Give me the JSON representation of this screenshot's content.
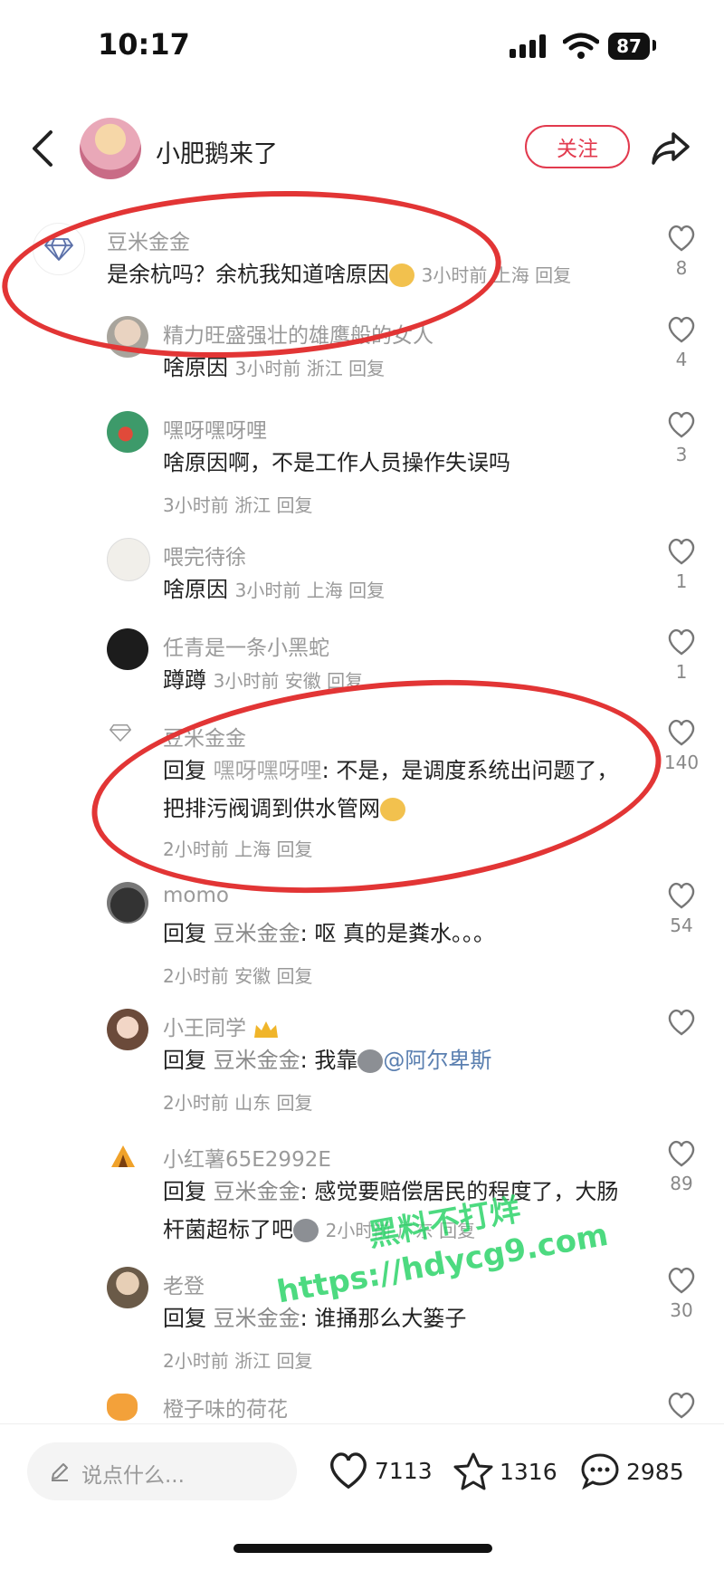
{
  "status": {
    "time": "10:17",
    "battery": "87"
  },
  "header": {
    "username": "小肥鹅来了",
    "follow_label": "关注"
  },
  "comments": [
    {
      "name": "豆米金金",
      "text": "是余杭吗？余杭我知道啥原因",
      "meta": "3小时前 上海 回复",
      "likes": "8"
    },
    {
      "name": "精力旺盛强壮的雄鹰般的女人",
      "text": "啥原因",
      "meta": "3小时前 浙江 回复",
      "likes": "4"
    },
    {
      "name": "嘿呀嘿呀哩",
      "text": "啥原因啊，不是工作人员操作失误吗",
      "meta": "3小时前 浙江 回复",
      "likes": "3"
    },
    {
      "name": "喂完待徐",
      "text": "啥原因",
      "meta": "3小时前 上海 回复",
      "likes": "1"
    },
    {
      "name": "任青是一条小黑蛇",
      "text": "蹲蹲",
      "meta": "3小时前 安徽 回复",
      "likes": "1"
    },
    {
      "name": "豆米金金",
      "reply_prefix": "回复",
      "reply_to": "嘿呀嘿呀哩",
      "text": ": 不是，是调度系统出问题了，把排污阀调到供水管网",
      "meta": "2小时前 上海 回复",
      "likes": "140"
    },
    {
      "name": "momo",
      "reply_prefix": "回复",
      "reply_to": "豆米金金",
      "text": ": 呕 真的是粪水。。。",
      "meta": "2小时前 安徽 回复",
      "likes": "54"
    },
    {
      "name": "小王同学",
      "reply_prefix": "回复",
      "reply_to": "豆米金金",
      "text": ": 我靠",
      "mention": "@阿尔卑斯",
      "meta": "2小时前 山东 回复",
      "likes": ""
    },
    {
      "name": "小红薯65E2992E",
      "reply_prefix": "回复",
      "reply_to": "豆米金金",
      "text": ": 感觉要赔偿居民的程度了，大肠杆菌超标了吧",
      "meta": "2小时前 广东 回复",
      "likes": "89"
    },
    {
      "name": "老登",
      "reply_prefix": "回复",
      "reply_to": "豆米金金",
      "text": ": 谁捅那么大篓子",
      "meta": "2小时前 浙江 回复",
      "likes": "30"
    },
    {
      "name": "橙子味的荷花",
      "text": "",
      "meta": "",
      "likes": ""
    }
  ],
  "watermark": {
    "line1": "黑料不打烊",
    "line2": "https://hdycg9.com"
  },
  "bottom": {
    "placeholder": "说点什么...",
    "likes": "7113",
    "stars": "1316",
    "comments": "2985"
  },
  "colors": {
    "accent": "#e23a4e",
    "annotation": "#e23535",
    "watermark": "#2ed46a"
  }
}
